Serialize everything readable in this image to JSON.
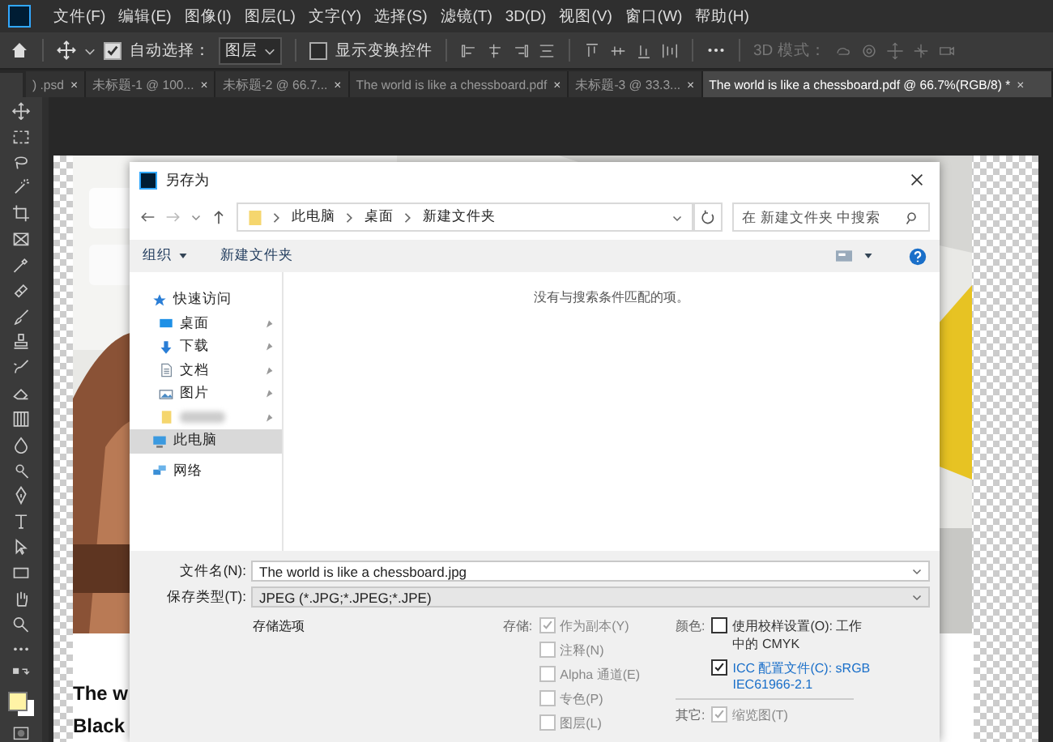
{
  "app_menu": [
    "文件(F)",
    "编辑(E)",
    "图像(I)",
    "图层(L)",
    "文字(Y)",
    "选择(S)",
    "滤镜(T)",
    "3D(D)",
    "视图(V)",
    "窗口(W)",
    "帮助(H)"
  ],
  "options_bar": {
    "auto_select": {
      "label": "自动选择：",
      "checked": true
    },
    "layer_dropdown": "图层",
    "show_transform": {
      "label": "显示变换控件",
      "checked": false
    },
    "mode_3d": "3D 模式："
  },
  "doc_tabs": [
    {
      "label": ") .psd",
      "close": "×",
      "selected": false
    },
    {
      "label": "未标题-1 @ 100...",
      "close": "×",
      "selected": false
    },
    {
      "label": "未标题-2 @ 66.7...",
      "close": "×",
      "selected": false
    },
    {
      "label": "The world is like a chessboard.pdf",
      "close": "×",
      "selected": false
    },
    {
      "label": "未标题-3 @ 33.3...",
      "close": "×",
      "selected": false
    },
    {
      "label": "The world is like a chessboard.pdf @ 66.7%(RGB/8) *",
      "close": "×",
      "selected": true
    }
  ],
  "document": {
    "text_lines": [
      "The w",
      "Black"
    ]
  },
  "dialog": {
    "title": "另存为",
    "breadcrumb": [
      "此电脑",
      "桌面",
      "新建文件夹"
    ],
    "search": {
      "placeholder": "在 新建文件夹 中搜索"
    },
    "toolbar": {
      "organize": "组织",
      "new_folder": "新建文件夹"
    },
    "nav": [
      {
        "label": "快速访问",
        "kind": "star",
        "selected": false,
        "children": [
          {
            "label": "桌面",
            "kind": "desktop",
            "pinned": true,
            "selected": false
          },
          {
            "label": "下载",
            "kind": "download",
            "pinned": true,
            "selected": false
          },
          {
            "label": "文档",
            "kind": "document",
            "pinned": true,
            "selected": false
          },
          {
            "label": "图片",
            "kind": "pictures",
            "pinned": true,
            "selected": false
          },
          {
            "kind": "folder",
            "pinned": true,
            "selected": false
          }
        ]
      },
      {
        "label": "此电脑",
        "kind": "computer",
        "selected": true
      },
      {
        "label": "网络",
        "kind": "network",
        "selected": false
      }
    ],
    "empty_message": "没有与搜索条件匹配的项。",
    "filename": {
      "label": "文件名(N):",
      "value": "The world is like a chessboard.jpg"
    },
    "file_type": {
      "label": "保存类型(T):",
      "value": "JPEG (*.JPG;*.JPEG;*.JPE)"
    },
    "options_title": "存储选项",
    "save_group": {
      "label": "存储:",
      "options": [
        {
          "label": "作为副本(Y)",
          "checked": true,
          "disabled": true
        },
        {
          "label": "注释(N)",
          "checked": false,
          "disabled": true
        },
        {
          "label": "Alpha 通道(E)",
          "checked": false,
          "disabled": true
        },
        {
          "label": "专色(P)",
          "checked": false,
          "disabled": true
        },
        {
          "label": "图层(L)",
          "checked": false,
          "disabled": true
        }
      ]
    },
    "color_group": {
      "label": "颜色:",
      "options": [
        {
          "label": "使用校样设置(O): 工作中的 CMYK",
          "checked": false,
          "disabled": false,
          "link": false
        },
        {
          "label": "ICC 配置文件(C): sRGB IEC61966-2.1",
          "checked": true,
          "disabled": false,
          "link": true
        }
      ]
    },
    "other_group": {
      "label": "其它:",
      "options": [
        {
          "label": "缩览图(T)",
          "checked": true,
          "disabled": true
        }
      ]
    }
  }
}
